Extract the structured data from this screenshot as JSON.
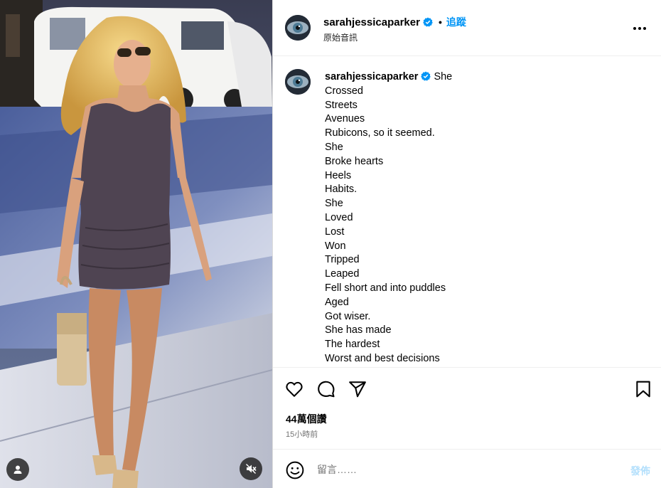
{
  "post": {
    "username": "sarahjessicaparker",
    "verified_icon": "verified-badge-icon",
    "follow_label": "追蹤",
    "separator": "•",
    "audio_label": "原始音訊",
    "more_icon": "more-options-icon"
  },
  "caption": {
    "username": "sarahjessicaparker",
    "lines": [
      "She",
      "Crossed",
      "Streets",
      "Avenues",
      "Rubicons, so it seemed.",
      "She",
      "Broke hearts",
      "Heels",
      "Habits.",
      "She",
      "Loved",
      "Lost",
      "Won",
      "Tripped",
      "Leaped",
      "Fell short and into puddles",
      "Aged",
      "Got wiser.",
      "She has made",
      "The hardest",
      "Worst and best decisions"
    ]
  },
  "actions": {
    "icons": [
      "heart-icon",
      "comment-icon",
      "share-icon",
      "bookmark-icon"
    ],
    "views": "44萬個讚",
    "time": "15小時前"
  },
  "comment": {
    "placeholder": "留言……",
    "post_label": "發佈"
  },
  "media": {
    "icons": [
      "user-tag-icon",
      "muted-audio-icon"
    ]
  },
  "colors": {
    "accent": "#0095f6",
    "post_disabled": "#b2dffc",
    "border": "#dbdbdb"
  }
}
